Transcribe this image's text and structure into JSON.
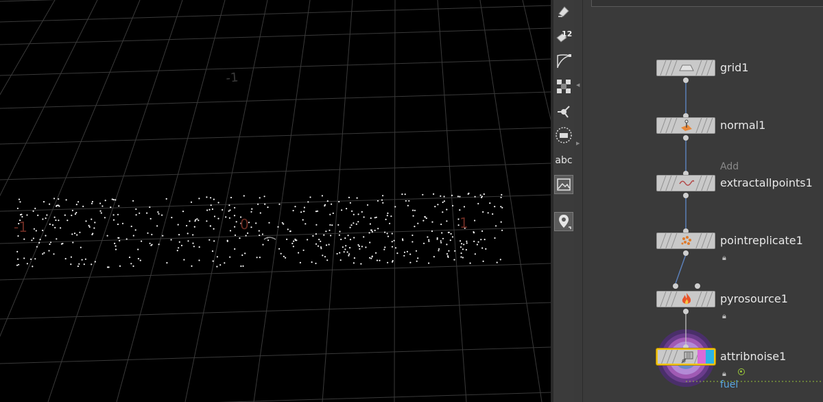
{
  "viewport": {
    "axis_labels": [
      "-1",
      "0",
      "1",
      "-1"
    ],
    "colors": {
      "background": "#000000",
      "grid": "#3a3a3a",
      "points": "#f5f5f5",
      "axis_label": "#6a2b22",
      "axis_label_far": "#3a3a3a"
    }
  },
  "toolbar": {
    "text_tool_label": "abc",
    "items": [
      {
        "icon": "paint-bucket-icon"
      },
      {
        "icon": "counter-12-icon",
        "badge": "12"
      },
      {
        "icon": "curve-tool-icon"
      },
      {
        "icon": "grid-snap-icon"
      },
      {
        "icon": "transform-handle-icon"
      },
      {
        "icon": "circle-select-icon"
      },
      {
        "icon": "text-icon"
      },
      {
        "icon": "image-icon"
      },
      {
        "icon": "location-pin-icon"
      }
    ]
  },
  "network": {
    "nodes": [
      {
        "name": "grid1",
        "icon": "grid-icon"
      },
      {
        "name": "normal1",
        "icon": "normal-icon"
      },
      {
        "name": "extractallpoints1",
        "subtitle": "Add",
        "icon": "wave-icon"
      },
      {
        "name": "pointreplicate1",
        "icon": "points-cluster-icon",
        "locked": true
      },
      {
        "name": "pyrosource1",
        "icon": "fire-icon",
        "locked": true
      },
      {
        "name": "attribnoise1",
        "icon": "noise-icon",
        "locked": true,
        "selected": true,
        "display_flag": true
      }
    ],
    "output_label": "fuel",
    "colors": {
      "selection": "#f1c40f",
      "wire": "#5b7fb8",
      "flag_cyan": "#2ab3e6",
      "flag_pink": "#d86bd8",
      "output_label": "#5aa6e0"
    }
  }
}
